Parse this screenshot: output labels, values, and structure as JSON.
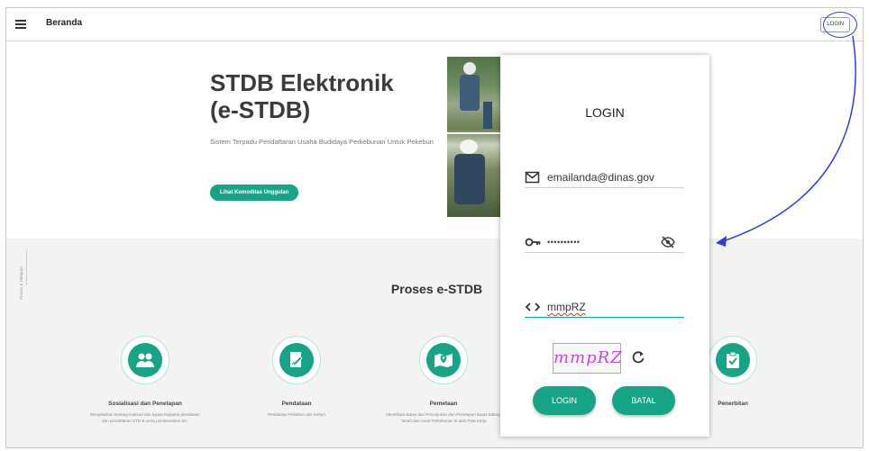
{
  "appbar": {
    "title": "Beranda",
    "login_label": "LOGIN"
  },
  "hero": {
    "title": "STDB Elektronik\n(e-STDB)",
    "subtitle": "Sistem Terpadu Pendaftaran Usaha Budidaya Perkebunan Untuk Pekebun",
    "button_label": "Lihat Komoditas Unggulan"
  },
  "process": {
    "side_label": "Proses & Tahapan",
    "title": "Proses e-STDB",
    "steps": [
      {
        "title": "Sosialisasi dan Penetapan",
        "desc": "Menjelaskan tentang maksud dan tujuan kegiatan pendataan dan pendaftaran STD-B serta pembentukan tim.",
        "icon": "people-icon"
      },
      {
        "title": "Pendataan",
        "desc": "Pendataan Pekebun dan Kebun",
        "icon": "edit-document-icon"
      },
      {
        "title": "Pemetaan",
        "desc": "Identifikasi Batas dan Penunjukan dan Penetapan Batas Bidang Tanah dan Areal Perkebunan di atas Peta Kerja",
        "icon": "map-pin-icon"
      },
      {
        "title": "Penerbitan",
        "desc": "",
        "icon": "clipboard-check-icon"
      }
    ]
  },
  "login_modal": {
    "title": "LOGIN",
    "email_value": "emailanda@dinas.gov",
    "password_value": "••••••••••",
    "captcha_value": "mmpRZ",
    "captcha_image_text": "mmpRZ",
    "login_button": "LOGIN",
    "cancel_button": "BATAL"
  },
  "colors": {
    "accent": "#17a486",
    "annotation": "#2d3fd6"
  }
}
